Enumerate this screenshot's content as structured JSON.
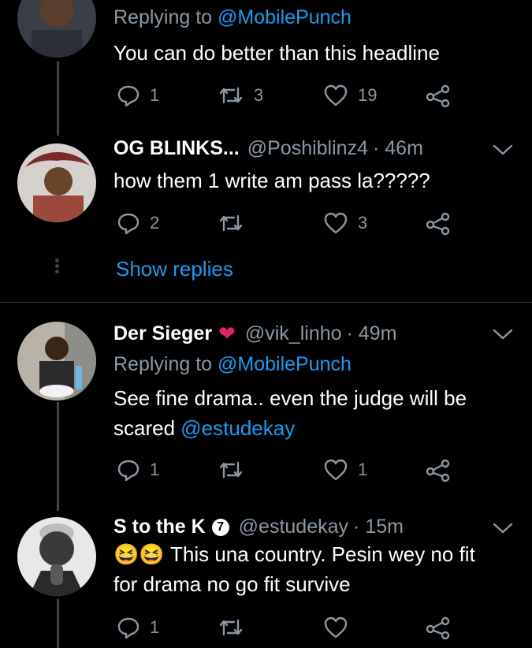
{
  "tweets": [
    {
      "reply_prefix": "Replying to",
      "reply_handle": "@MobilePunch",
      "text": "You can do better than this headline",
      "actions": {
        "reply": "1",
        "retweet": "3",
        "like": "19"
      }
    },
    {
      "name": "OG BLINKS...",
      "handle": "@Poshiblinz4",
      "time": "· 46m",
      "text": "how them 1 write am pass la?????",
      "actions": {
        "reply": "2",
        "retweet": "",
        "like": "3"
      },
      "show_replies": "Show replies"
    },
    {
      "name": "Der Sieger",
      "name_emoji": "❤",
      "handle": "@vik_linho",
      "time": "· 49m",
      "reply_prefix": "Replying to",
      "reply_handle": "@MobilePunch",
      "text": "See fine drama.. even the judge will be scared",
      "text_mention": "@estudekay",
      "actions": {
        "reply": "1",
        "retweet": "",
        "like": "1"
      }
    },
    {
      "name": "S to the K",
      "badge": "7",
      "handle": "@estudekay",
      "time": "· 15m",
      "emojis": "😆😆",
      "text_line1": "This una country. Pesin wey no fit",
      "text_line2": "for drama no go fit survive",
      "actions": {
        "reply": "1",
        "retweet": "",
        "like": ""
      }
    }
  ],
  "colors": {
    "background": "#000000",
    "link": "#1d9bf0",
    "muted": "#8b98a5",
    "heart": "#e0245e"
  }
}
